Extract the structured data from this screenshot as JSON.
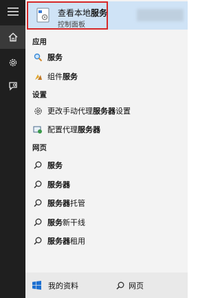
{
  "sidebar": {
    "menu_icon": "hamburger-icon",
    "home_icon": "home-icon",
    "settings_icon": "gear-icon",
    "feedback_icon": "feedback-icon"
  },
  "top_result": {
    "title_pre": "查看本地",
    "title_bold": "服务",
    "subtitle": "控制面板",
    "icon": "services-app-icon"
  },
  "sections": {
    "apps": "应用",
    "settings": "设置",
    "web": "网页"
  },
  "apps": [
    {
      "pre": "",
      "bold": "服务",
      "icon": "search-magnifier-colored-icon"
    },
    {
      "pre": "组件",
      "bold": "服务",
      "icon": "component-services-icon"
    }
  ],
  "settings": [
    {
      "pre": "更改手动代理",
      "bold": "服务器",
      "post": "设置",
      "icon": "gear-icon"
    },
    {
      "pre": "配置代理",
      "bold": "服务器",
      "post": "",
      "icon": "proxy-config-icon"
    }
  ],
  "web": [
    {
      "bold": "服务",
      "post": ""
    },
    {
      "bold": "服务器",
      "post": ""
    },
    {
      "bold": "服务器",
      "post": "托管"
    },
    {
      "bold": "服务",
      "post": "新干线"
    },
    {
      "bold": "服务器",
      "post": "租用"
    }
  ],
  "bottom": {
    "my_stuff": "我的资料",
    "web": "网页"
  }
}
